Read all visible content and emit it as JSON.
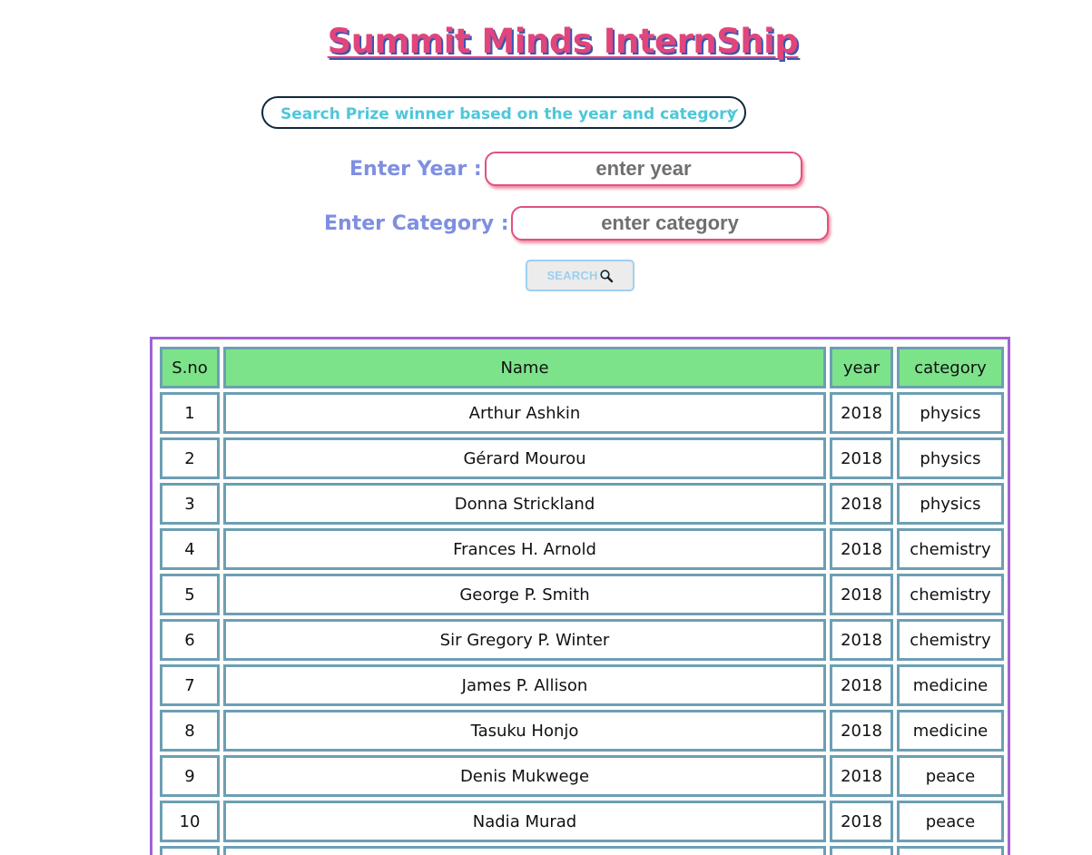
{
  "header": {
    "title": "Summit Minds InternShip"
  },
  "search_form": {
    "select_label": "Search Prize winner based on the year and category",
    "year_label": "Enter Year :",
    "year_placeholder": "enter year",
    "category_label": "Enter Category :",
    "category_placeholder": "enter category",
    "search_button_label": "SEARCH",
    "search_icon": "magnifier-icon"
  },
  "table": {
    "columns": [
      "S.no",
      "Name",
      "year",
      "category"
    ],
    "rows": [
      [
        "1",
        "Arthur Ashkin",
        "2018",
        "physics"
      ],
      [
        "2",
        "Gérard Mourou",
        "2018",
        "physics"
      ],
      [
        "3",
        "Donna Strickland",
        "2018",
        "physics"
      ],
      [
        "4",
        "Frances H. Arnold",
        "2018",
        "chemistry"
      ],
      [
        "5",
        "George P. Smith",
        "2018",
        "chemistry"
      ],
      [
        "6",
        "Sir Gregory P. Winter",
        "2018",
        "chemistry"
      ],
      [
        "7",
        "James P. Allison",
        "2018",
        "medicine"
      ],
      [
        "8",
        "Tasuku Honjo",
        "2018",
        "medicine"
      ],
      [
        "9",
        "Denis Mukwege",
        "2018",
        "peace"
      ],
      [
        "10",
        "Nadia Murad",
        "2018",
        "peace"
      ]
    ]
  },
  "colors": {
    "title": "#e0457b",
    "title_shadow": "#3a55b0",
    "select_text": "#4ec7d9",
    "form_label": "#7f8fe0",
    "input_border": "#e0527c",
    "header_bg": "#7de38a",
    "cell_border": "#6c9fb3",
    "table_frame": "#a461d6"
  }
}
